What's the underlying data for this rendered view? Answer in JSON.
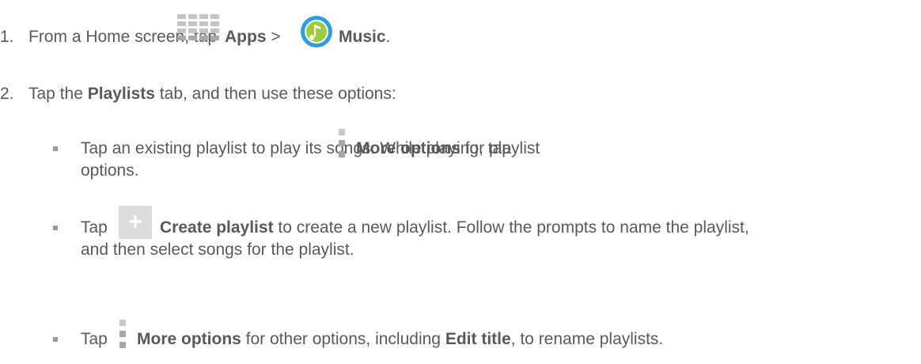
{
  "step1": {
    "number": "1.",
    "text_before": "From a Home screen, tap ",
    "apps_label": "Apps",
    "separator": " > ",
    "music_label": "Music",
    "end": ".",
    "icons": [
      "apps-grid-icon",
      "music-note-icon"
    ]
  },
  "step2": {
    "number": "2.",
    "text_before": "Tap the ",
    "playlists_label": "Playlists",
    "text_after": " tab, and then use these options:"
  },
  "bullets": [
    {
      "text_before": "Tap an existing playlist to play its songs. While playing, tap ",
      "bold": "More options",
      "text_after": " for playlist",
      "continuation": "options."
    },
    {
      "text_before": "Tap ",
      "bold": "Create playlist",
      "text_after": " to create a new playlist. Follow the prompts to name the playlist,",
      "continuation": "and then select songs for the playlist."
    },
    {
      "text_before": "Tap ",
      "bold": "More options",
      "text_after": " for other options, including ",
      "bold2": "Edit title",
      "text_end": ", to rename playlists."
    }
  ],
  "colors": {
    "text": "#595959",
    "music_icon_blue": "#2c9ee0",
    "music_icon_green": "#9ccc3c"
  }
}
